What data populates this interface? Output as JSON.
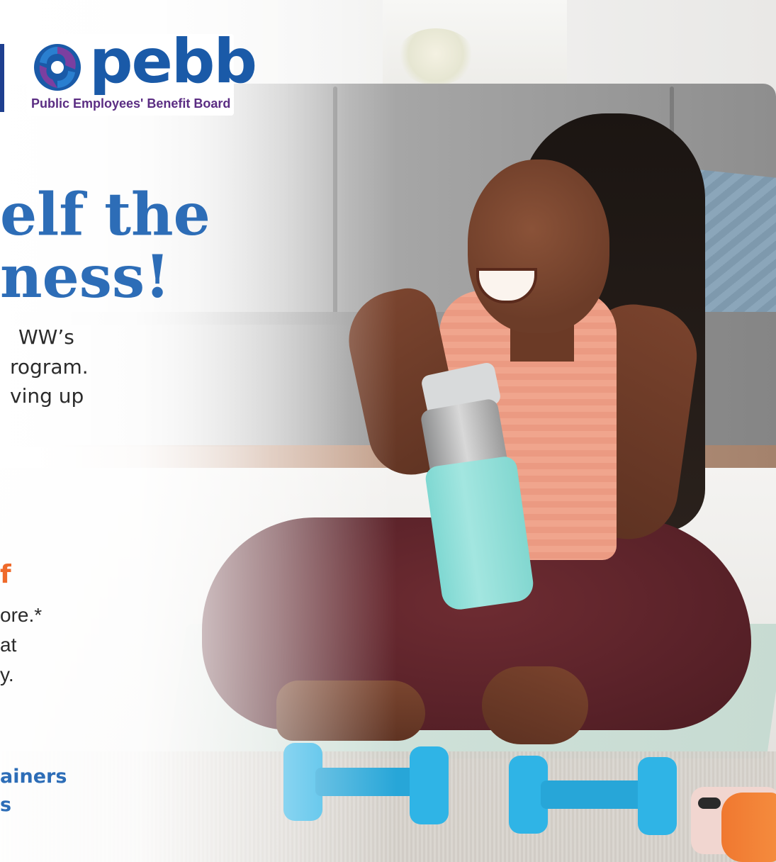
{
  "logo": {
    "wordmark": "pebb",
    "subtitle": "Public Employees' Benefit Board",
    "icon": "pebb-hands-icon",
    "colors": {
      "word": "#1a5aa8",
      "sub": "#5b2d83"
    }
  },
  "headline": {
    "line1": "elf the",
    "line2": "ness!"
  },
  "intro": {
    "line1": "WW’s",
    "line2": "rogram.",
    "line3": "ving up"
  },
  "offer": {
    "heading": "f",
    "line1": "ore.*",
    "line2": "at",
    "line3": "y."
  },
  "features": {
    "line1": "ainers",
    "line2": "s"
  },
  "colors": {
    "headline_blue": "#2d6db7",
    "accent_orange": "#ef6a2b",
    "dumbbell_blue": "#2fb4e6"
  }
}
